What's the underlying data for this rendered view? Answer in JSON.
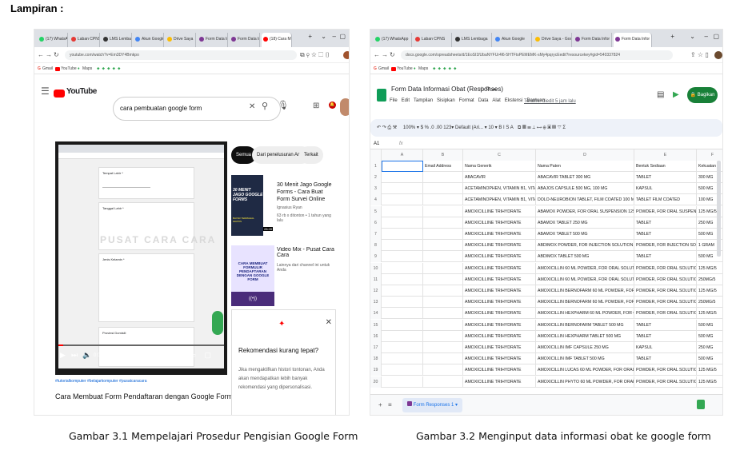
{
  "heading": "Lampiran :",
  "captions": {
    "fig1": "Gambar 3.1 Mempelajari Prosedur Pengisian Google Form",
    "fig2": "Gambar 3.2 Menginput data informasi obat ke google form"
  },
  "shot1": {
    "tabs": [
      "(17) WhatsApp",
      "Laban CPNS",
      "LMS Lembaga",
      "Akun Google",
      "Drive Saya",
      "Form Data In",
      "Form Data In",
      "(18) Cara M"
    ],
    "url": "youtube.com/watch?v=Em3DY4Bmkpo",
    "bookmarks": [
      "Gmail",
      "YouTube",
      "Maps"
    ],
    "logo": "YouTube",
    "search_value": "cara pembuatan google form",
    "chips": [
      "Semua",
      "Dari penelusuran Anda",
      "Terkait"
    ],
    "video_time": "0:02 / 17:02",
    "hashtags": "#tutorialkomputer #belajarkomputer #pusatcaracara",
    "video_title": "Cara Membuat Form Pendaftaran dengan Google Form",
    "watermark": "PUSAT CARA CARA",
    "form_labels": [
      "Tempat Lahir *",
      "Tanggal Lahir *",
      "Jenis Kelamin *",
      "Provinsi Domisili"
    ],
    "related": [
      {
        "title": "30 Menit Jago Google Forms - Cara Buat Form Survei Online",
        "channel": "Ignasius Ryan",
        "meta": "63 rb x ditonton • 1 tahun yang lalu",
        "thumb_text": "30 MENIT JAGO GOOGLE FORMS",
        "thumb_sub": "BAYAR TERMAHAL GRATIS",
        "duration": "28:28"
      },
      {
        "title": "Video Mix - Pusat Cara Cara",
        "channel": "Lainnya dari channel ini untuk Anda",
        "meta": "",
        "thumb_text": "CARA MEMBUAT FORMULIR PENDAFTARAN DENGAN GOOGLE FORM",
        "duration": ""
      }
    ],
    "rec_title": "Rekomendasi kurang tepat?",
    "rec_body": "Jika mengaktifkan histori tontonan, Anda akan mendapatkan lebih banyak rekomendasi yang dipersonalisasi."
  },
  "shot2": {
    "tabs": [
      "(17) WhatsApp",
      "Laban CPNS",
      "LMS Lembaga",
      "Akun Google",
      "Drive Saya - Goo",
      "Form Data Infor",
      "Form Data Infor"
    ],
    "url": "docs.google.com/spreadsheets/d/1EoSI1fUbaNYFUr4l6-5HTFtsPEMEMK-sMy4pqrycEedit?resourcekey#gid=540337824",
    "bookmarks": [
      "Gmail",
      "YouTube",
      "Maps"
    ],
    "doc_title": "Form Data Informasi Obat (Responses)",
    "menu": [
      "File",
      "Edit",
      "Tampilan",
      "Sisipkan",
      "Format",
      "Data",
      "Alat",
      "Ekstensi",
      "Bantuan"
    ],
    "last_edit": "Terakhir diedit 5 jam lalu",
    "share_label": "Bagikan",
    "toolbar_text": "100%  ▾   $  %  .0  .00  123▾   Default (Ari... ▾   10  ▾   B  I  S  A",
    "cell_ref": "A1",
    "columns": [
      "A",
      "B",
      "C",
      "D",
      "E",
      "F"
    ],
    "headers": [
      "",
      "Email Address",
      "Nama Generik",
      "Nama Paten",
      "Bentuk Sediaan",
      "Kekuatan"
    ],
    "rows": [
      [
        "",
        "",
        "ABACAVIR",
        "ABACAVIR TABLET 300 MG",
        "TABLET",
        "300 MG"
      ],
      [
        "",
        "",
        "ACETAMINOPHEN, VITAMIN B1, VITAMIN B",
        "ABAJOS CAPSULE 500 MG, 100 MG",
        "KAPSUL",
        "500 MG"
      ],
      [
        "",
        "",
        "ACETAMINOPHEN, VITAMIN B1, VITAMIN B",
        "DOLO-NEUROBION TABLET, FILM COATED 100 MCG, 100",
        "TABLET FILM COATED",
        "100 MG"
      ],
      [
        "",
        "",
        "AMOXICILLINE TRIHYDRATE",
        "ABAMOX POWDER, FOR ORAL SUSPENSION 125 MG/5 M",
        "POWDER, FOR ORAL SUSPENSION",
        "125 MG/5"
      ],
      [
        "",
        "",
        "AMOXICILLINE TRIHYDRATE",
        "ABAMOX TABLET 250 MG",
        "TABLET",
        "250 MG"
      ],
      [
        "",
        "",
        "AMOXICILLINE TRIHYDRATE",
        "ABAMOX TABLET 500 MG",
        "TABLET",
        "500 MG"
      ],
      [
        "",
        "",
        "AMOXICILLINE TRIHYDRATE",
        "ABDIMOX POWDER, FOR INJECTION SOLUTION 1 GM",
        "POWDER, FOR INJECTION SOLUTION",
        "1 GRAM"
      ],
      [
        "",
        "",
        "AMOXICILLINE TRIHYDRATE",
        "ABDIMOX TABLET 500 MG",
        "TABLET",
        "500 MG"
      ],
      [
        "",
        "",
        "AMOXICILLINE TRIHYDRATE",
        "AMOXICILLIN 60 ML POWDER, FOR ORAL SOLUTION 125",
        "POWDER, FOR ORAL SOLUTION",
        "125 MG/5"
      ],
      [
        "",
        "",
        "AMOXICILLINE TRIHYDRATE",
        "AMOXICILLIN 60 ML POWDER, FOR ORAL SOLUTION 250",
        "POWDER, FOR ORAL SOLUTION",
        "250MG/5"
      ],
      [
        "",
        "",
        "AMOXICILLINE TRIHYDRATE",
        "AMOXICILLIN BERNOFARM 60 ML POWDER, FOR ORAL S",
        "POWDER, FOR ORAL SOLUTION",
        "125 MG/5"
      ],
      [
        "",
        "",
        "AMOXICILLINE TRIHYDRATE",
        "AMOXICILLIN BERNOFARM 60 ML POWDER, FOR ORAL S",
        "POWDER, FOR ORAL SOLUTION",
        "250MG/5"
      ],
      [
        "",
        "",
        "AMOXICILLINE TRIHYDRATE",
        "AMOXICILLIN HEXPHARM 60 ML POWDER, FOR ORAL SO",
        "POWDER, FOR ORAL SOLUTION",
        "125 MG/5"
      ],
      [
        "",
        "",
        "AMOXICILLINE TRIHYDRATE",
        "AMOXICILLIN BERNOFARM TABLET 500 MG",
        "TABLET",
        "500 MG"
      ],
      [
        "",
        "",
        "AMOXICILLINE TRIHYDRATE",
        "AMOXICILLIN HEXPHARM TABLET 500 MG",
        "TABLET",
        "500 MG"
      ],
      [
        "",
        "",
        "AMOXICILLINE TRIHYDRATE",
        "AMOXICILLIN IMF CAPSULE 250 MG",
        "KAPSUL",
        "250 MG"
      ],
      [
        "",
        "",
        "AMOXICILLINE TRIHYDRATE",
        "AMOXICILLIN IMF TABLET 500 MG",
        "TABLET",
        "500 MG"
      ],
      [
        "",
        "",
        "AMOXICILLINE TRIHYDRATE",
        "AMOXICILLIN LUCAS 60 ML POWDER, FOR ORAL SOLUT",
        "POWDER, FOR ORAL SOLUTION",
        "125 MG/5"
      ],
      [
        "",
        "",
        "AMOXICILLINE TRIHYDRATE",
        "AMOXICILLIN PHYTO 60 ML POWDER, FOR ORAL SOLUT",
        "POWDER, FOR ORAL SOLUTION",
        "125 MG/5"
      ]
    ],
    "sheet_tab": "Form Responses 1"
  },
  "colors": {
    "yt_red": "#ff0000",
    "sheets_green": "#0f9d58",
    "share_green": "#188038",
    "select_blue": "#1a73e8"
  }
}
